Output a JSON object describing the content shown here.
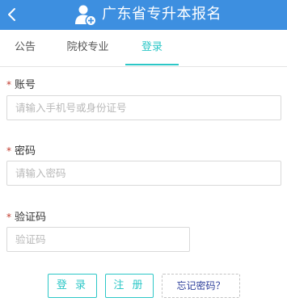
{
  "header": {
    "title": "广东省专升本报名",
    "back_icon": "chevron-left-icon",
    "logo_icon": "user-plus-icon"
  },
  "tabs": [
    {
      "label": "公告",
      "active": false
    },
    {
      "label": "院校专业",
      "active": false
    },
    {
      "label": "登录",
      "active": true
    }
  ],
  "form": {
    "required_mark": "*",
    "account": {
      "label": "账号",
      "value": "",
      "placeholder": "请输入手机号或身份证号"
    },
    "password": {
      "label": "密码",
      "value": "",
      "placeholder": "请输入密码"
    },
    "captcha": {
      "label": "验证码",
      "value": "",
      "placeholder": "验证码"
    }
  },
  "buttons": {
    "login": "登 录",
    "register": "注 册",
    "forgot": "忘记密码？"
  },
  "colors": {
    "header_bg": "#3d8fe0",
    "accent": "#2cc7c7",
    "required": "#c0392b",
    "forgot_text": "#2c3e9a"
  }
}
